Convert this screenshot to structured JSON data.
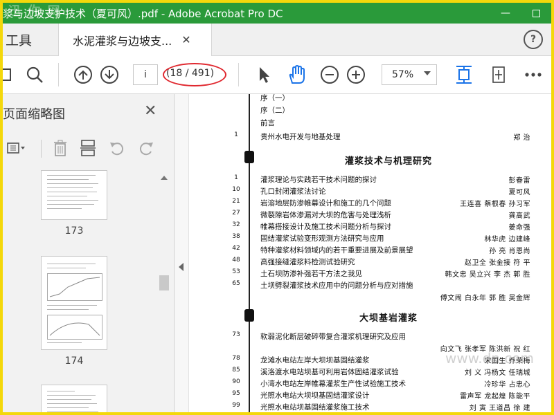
{
  "window": {
    "title": "浆与边坡支护技术（夏可风）.pdf - Adobe Acrobat Pro DC",
    "watermark": "迅 你 网",
    "minimize": "—",
    "close": "✕"
  },
  "tabs": {
    "tools_label": "工具",
    "doc_tab_label": "水泥灌浆与边坡支...",
    "doc_tab_close": "✕",
    "help": "?"
  },
  "toolbar": {
    "page_input": "i",
    "page_count": "(18 / 491)",
    "zoom": "57%"
  },
  "panel": {
    "title": "页面缩略图",
    "close": "✕",
    "thumbnails": [
      {
        "label": "173"
      },
      {
        "label": "174"
      }
    ]
  },
  "document": {
    "front_rows": [
      {
        "title": "序（一）"
      },
      {
        "title": "序（二）"
      },
      {
        "title": "前言"
      }
    ],
    "intro": {
      "page": "1",
      "title": "贵州水电开发与地基处理",
      "authors": "郑  治"
    },
    "sections": [
      {
        "heading": "灌浆技术与机理研究",
        "items": [
          {
            "page": "1",
            "title": "灌浆理论与实践若干技术问题的探讨",
            "authors": "彭春雷"
          },
          {
            "page": "10",
            "title": "孔口封闭灌浆法讨论",
            "authors": "夏可风"
          },
          {
            "page": "21",
            "title": "岩溶地层防渗帷幕设计和施工的几个问题",
            "authors": "王连喜   蔡根春   孙习军"
          },
          {
            "page": "27",
            "title": "微裂隙岩体渗漏对大坝的危害与处理浅析",
            "authors": "龚高武"
          },
          {
            "page": "32",
            "title": "帷幕搭接设计及施工技术问题分析与探讨",
            "authors": "姜命强"
          },
          {
            "page": "38",
            "title": "固结灌浆试验变形观测方法研究与应用",
            "authors": "林华虎   边建峰"
          },
          {
            "page": "42",
            "title": "特种灌浆材料领域内的若干重要进展及前景展望",
            "authors": "孙  亮   肖恩尚"
          },
          {
            "page": "48",
            "title": "高强接缝灌浆料检测试验研究",
            "authors": "赵卫全   张金接   符  平"
          },
          {
            "page": "53",
            "title": "土石坝防渗补强若干方法之我见",
            "authors": "韩文忠   吴立兴   李  杰   郭  胜"
          },
          {
            "page": "65",
            "title": "土坝劈裂灌浆技术应用中的问题分析与应对措施",
            "authors": ""
          },
          {
            "page": "",
            "title": "",
            "authors": "傅文闹   白永年   郭  胜   吴金辉"
          }
        ]
      },
      {
        "heading": "大坝基岩灌浆",
        "items": [
          {
            "page": "73",
            "title": "软弱泥化断层破碎带复合灌浆机理研究及应用",
            "authors": ""
          },
          {
            "page": "",
            "title": "",
            "authors": "向文飞   张孝军   陈洪新   祝  红"
          },
          {
            "page": "78",
            "title": "龙滩水电站左岸大坝坝基固结灌浆",
            "authors": "宋国生   乔荣梅"
          },
          {
            "page": "85",
            "title": "溪洛渡水电站坝基可利用岩体固结灌浆试验",
            "authors": "刘  义   冯杨文   任瑞城"
          },
          {
            "page": "90",
            "title": "小湾水电站左岸帷幕灌浆生产性试验施工技术",
            "authors": "冷珍华   占忠心"
          },
          {
            "page": "95",
            "title": "光照水电站大坝坝基固结灌浆设计",
            "authors": "雷声军   龙起煌   陈能平"
          },
          {
            "page": "99",
            "title": "光照水电站坝基固结灌浆施工技术",
            "authors": "刘  寅   王道昌   徐  建"
          }
        ]
      }
    ],
    "watermark": "www.dn.com"
  }
}
